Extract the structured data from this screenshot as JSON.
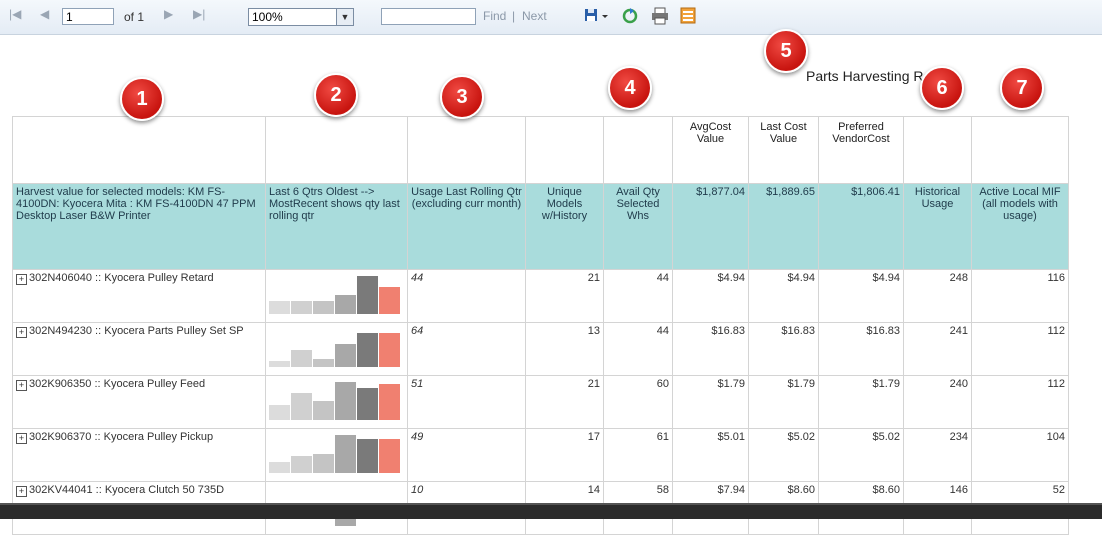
{
  "toolbar": {
    "first_icon": "first-page-icon",
    "prev_icon": "prev-page-icon",
    "page_value": "1",
    "of_pages": "of 1",
    "next_icon": "next-page-icon",
    "last_icon": "last-page-icon",
    "zoom_value": "100%",
    "find_value": "",
    "find_label": "Find",
    "separator": "|",
    "next_label": "Next",
    "export_icon": "save-export-icon",
    "refresh_icon": "refresh-icon",
    "print_icon": "print-icon",
    "layout_icon": "print-layout-icon"
  },
  "report_title": "Parts Harvesting Report",
  "markers": [
    "1",
    "2",
    "3",
    "4",
    "5",
    "6",
    "7"
  ],
  "header_top": {
    "avgcost": "AvgCost Value",
    "lastcost": "Last Cost Value",
    "preferred": "Preferred VendorCost"
  },
  "header_band": {
    "harvest": "Harvest value for selected models: KM FS-4100DN: Kyocera Mita : KM FS-4100DN 47 PPM Desktop Laser B&W Printer",
    "last6": "Last 6 Qtrs Oldest --> MostRecent shows qty last rolling qtr",
    "usage": "Usage Last Rolling Qtr (excluding curr month)",
    "unique": "Unique Models w/History",
    "avail": "Avail Qty Selected Whs",
    "avgcost_total": "$1,877.04",
    "lastcost_total": "$1,889.65",
    "preferred_total": "$1,806.41",
    "historical": "Historical Usage",
    "mif": "Active Local MIF (all models with usage)"
  },
  "rows": [
    {
      "part": "302N406040 :: Kyocera Pulley Retard",
      "spark": [
        0.35,
        0.35,
        0.35,
        0.5,
        1.0,
        0.7
      ],
      "usage": "44",
      "unique": "21",
      "avail": "44",
      "avg": "$4.94",
      "last": "$4.94",
      "pref": "$4.94",
      "hist": "248",
      "mif": "116"
    },
    {
      "part": "302N494230 :: Kyocera Parts Pulley Set SP",
      "spark": [
        0.15,
        0.45,
        0.2,
        0.6,
        0.9,
        0.9
      ],
      "usage": "64",
      "unique": "13",
      "avail": "44",
      "avg": "$16.83",
      "last": "$16.83",
      "pref": "$16.83",
      "hist": "241",
      "mif": "112"
    },
    {
      "part": "302K906350 :: Kyocera Pulley Feed",
      "spark": [
        0.4,
        0.7,
        0.5,
        1.0,
        0.85,
        0.95
      ],
      "usage": "51",
      "unique": "21",
      "avail": "60",
      "avg": "$1.79",
      "last": "$1.79",
      "pref": "$1.79",
      "hist": "240",
      "mif": "112"
    },
    {
      "part": "302K906370 :: Kyocera Pulley Pickup",
      "spark": [
        0.3,
        0.45,
        0.5,
        1.0,
        0.9,
        0.9
      ],
      "usage": "49",
      "unique": "17",
      "avail": "61",
      "avg": "$5.01",
      "last": "$5.02",
      "pref": "$5.02",
      "hist": "234",
      "mif": "104"
    },
    {
      "part": "302KV44041 :: Kyocera Clutch 50 735D",
      "spark": [
        0,
        0,
        0,
        0.6,
        0,
        0
      ],
      "usage": "10",
      "unique": "14",
      "avail": "58",
      "avg": "$7.94",
      "last": "$8.60",
      "pref": "$8.60",
      "hist": "146",
      "mif": "52"
    }
  ],
  "colors": {
    "header_band": "#a9dcdc",
    "marker": "#d9221b",
    "spark_recent": "#f08070"
  }
}
